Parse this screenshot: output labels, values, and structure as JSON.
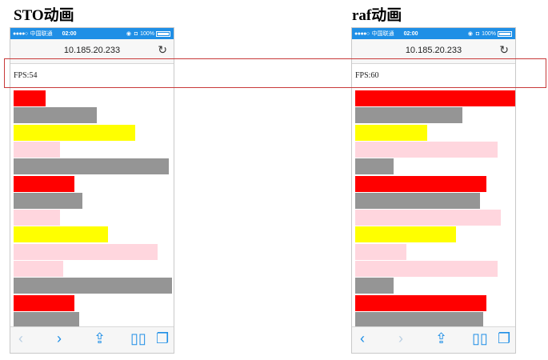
{
  "captions": {
    "left": "STO动画",
    "right": "raf动画"
  },
  "phones": [
    {
      "status": {
        "signal": "●●●●○",
        "carrier": "中国联通",
        "time": "02:00",
        "battery": "100%"
      },
      "url": "10.185.20.233",
      "fps": "FPS:54",
      "bars": [
        {
          "color": "#ff0000",
          "value": 0.2
        },
        {
          "color": "#959595",
          "value": 0.52
        },
        {
          "color": "#ffff00",
          "value": 0.76
        },
        {
          "color": "#ffd6de",
          "value": 0.29
        },
        {
          "color": "#959595",
          "value": 0.97
        },
        {
          "color": "#ff0000",
          "value": 0.38
        },
        {
          "color": "#959595",
          "value": 0.43
        },
        {
          "color": "#ffd6de",
          "value": 0.29
        },
        {
          "color": "#ffff00",
          "value": 0.59
        },
        {
          "color": "#ffd6de",
          "value": 0.9
        },
        {
          "color": "#ffd6de",
          "value": 0.31
        },
        {
          "color": "#959595",
          "value": 0.99
        },
        {
          "color": "#ff0000",
          "value": 0.38
        },
        {
          "color": "#959595",
          "value": 0.41
        }
      ],
      "toolbar": {
        "back_enabled": false,
        "forward_enabled": true
      }
    },
    {
      "status": {
        "signal": "●●●●○",
        "carrier": "中国联通",
        "time": "02:00",
        "battery": "100%"
      },
      "url": "10.185.20.233",
      "fps": "FPS:60",
      "bars": [
        {
          "color": "#ff0000",
          "value": 1.0
        },
        {
          "color": "#959595",
          "value": 0.67
        },
        {
          "color": "#ffff00",
          "value": 0.45
        },
        {
          "color": "#ffd6de",
          "value": 0.89
        },
        {
          "color": "#959595",
          "value": 0.24
        },
        {
          "color": "#ff0000",
          "value": 0.82
        },
        {
          "color": "#959595",
          "value": 0.78
        },
        {
          "color": "#ffd6de",
          "value": 0.91
        },
        {
          "color": "#ffff00",
          "value": 0.63
        },
        {
          "color": "#ffd6de",
          "value": 0.32
        },
        {
          "color": "#ffd6de",
          "value": 0.89
        },
        {
          "color": "#959595",
          "value": 0.24
        },
        {
          "color": "#ff0000",
          "value": 0.82
        },
        {
          "color": "#959595",
          "value": 0.8
        }
      ],
      "toolbar": {
        "back_enabled": true,
        "forward_enabled": false
      }
    }
  ]
}
